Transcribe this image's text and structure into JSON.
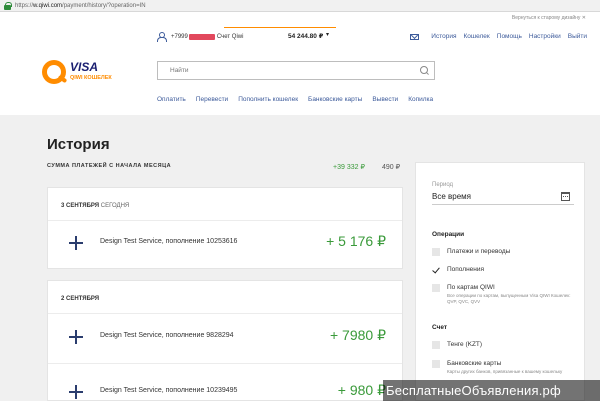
{
  "browser": {
    "url_prefix": "https://",
    "url_domain": "w.qiwi.com",
    "url_path": "/payment/history/?operation=IN"
  },
  "header": {
    "classic_link": "Вернуться к старому дизайну ✕",
    "phone": "+7999",
    "wallet_label": "Счет Qiwi",
    "balance": "54 244.80 ₽",
    "balance_caret": "▾",
    "nav": [
      "История",
      "Кошелек",
      "Помощь",
      "Настройки",
      "Выйти"
    ],
    "accent_color": "#ff8c00"
  },
  "logo": {
    "visa": "VISA",
    "subtitle": "QIWI КОШЕЛЕК"
  },
  "search": {
    "placeholder": "Найти"
  },
  "main_nav": [
    "Оплатить",
    "Перевести",
    "Пополнить кошелек",
    "Банковские карты",
    "Вывести",
    "Копилка"
  ],
  "history": {
    "title": "История",
    "sum_label": "СУММА ПЛАТЕЖЕЙ С НАЧАЛА МЕСЯЦА",
    "sum_in": "+39 332 ₽",
    "sum_out": "490 ₽",
    "groups": [
      {
        "date": "3 СЕНТЯБРЯ",
        "today": "СЕГОДНЯ",
        "transactions": [
          {
            "description": "Design Test Service, пополнение 10253616",
            "amount": "+ 5 176 ₽"
          }
        ]
      },
      {
        "date": "2 СЕНТЯБРЯ",
        "transactions": [
          {
            "description": "Design Test Service, пополнение 9828294",
            "amount": "+ 7980 ₽"
          },
          {
            "description": "Design Test Service, пополнение 10239495",
            "amount": "+ 980 ₽"
          }
        ]
      }
    ]
  },
  "filter": {
    "period_label": "Период",
    "period_value": "Все время",
    "operations_title": "Операции",
    "operations": [
      {
        "label": "Платежи и переводы",
        "checked": false
      },
      {
        "label": "Пополнения",
        "checked": true
      },
      {
        "label": "По картам QIWI",
        "checked": false,
        "hint": "Все операции по картам, выпущенным Visa QIWI Кошелек: QVP, QVC, QVV"
      }
    ],
    "account_title": "Счет",
    "accounts": [
      {
        "label": "Тенге (KZT)",
        "checked": false
      },
      {
        "label": "Банковские карты",
        "checked": false,
        "hint": "Карты других банков, привязанные к вашему кошельку"
      }
    ]
  },
  "watermark": {
    "text": "БесплатныеОбъявления.рф"
  }
}
